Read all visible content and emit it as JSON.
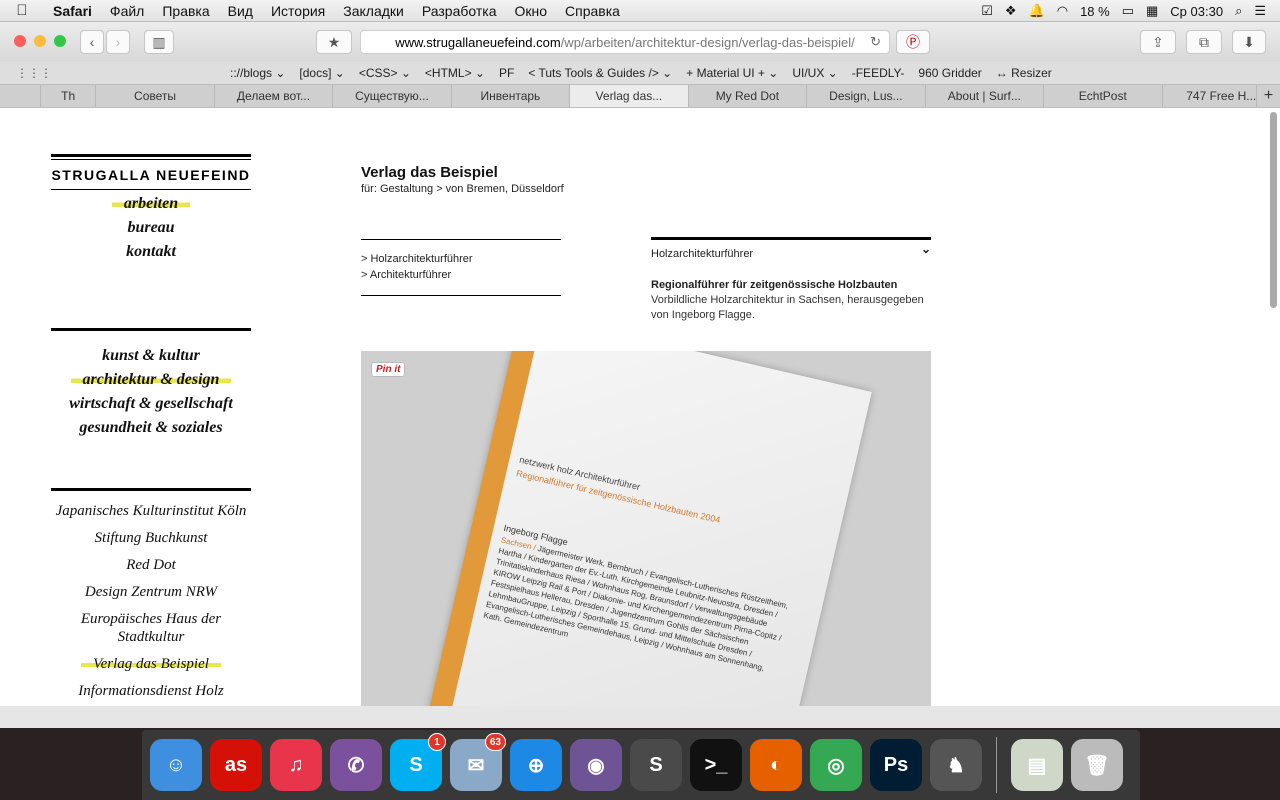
{
  "menubar": {
    "app": "Safari",
    "items": [
      "Файл",
      "Правка",
      "Вид",
      "История",
      "Закладки",
      "Разработка",
      "Окно",
      "Справка"
    ],
    "battery": "18 %",
    "clock": "Ср 03:30"
  },
  "toolbar": {
    "url_host": "www.strugallaneuefeind.com",
    "url_path": "/wp/arbeiten/architektur-design/verlag-das-beispiel/"
  },
  "bookmarks": [
    ":://blogs ⌄",
    "[docs] ⌄",
    "<CSS> ⌄",
    "<HTML> ⌄",
    "PF",
    "< Tuts Tools & Guides /> ⌄",
    "+ Material UI + ⌄",
    "UI/UX ⌄",
    "-FEEDLY-",
    "960 Gridder",
    "↔ Resizer"
  ],
  "tabs": [
    "Th",
    "Советы",
    "Делаем вот...",
    "Существую...",
    "Инвентарь",
    "Verlag das...",
    "My Red Dot",
    "Design, Lus...",
    "About | Surf...",
    "EchtPost",
    "747 Free H..."
  ],
  "active_tab": "Verlag das...",
  "sidebar": {
    "brand": "STRUGALLA NEUEFEIND",
    "nav": [
      "arbeiten",
      "bureau",
      "kontakt"
    ],
    "categories": [
      "kunst & kultur",
      "architektur & design",
      "wirtschaft & gesellschaft",
      "gesundheit & soziales"
    ],
    "clients": [
      "Japanisches Kulturinstitut Köln",
      "Stiftung Buchkunst",
      "Red Dot",
      "Design Zentrum NRW",
      "Europäisches Haus der Stadtkultur",
      "Verlag das Beispiel",
      "Informationsdienst Holz"
    ]
  },
  "main": {
    "title": "Verlag das Beispiel",
    "subtitle": "für: Gestaltung > von Bremen, Düsseldorf",
    "links": [
      "> Holzarchitekturführer",
      "> Architekturführer"
    ],
    "dropdown": "Holzarchitekturführer",
    "desc_head": "Regionalführer für zeitgenössische Holzbauten",
    "desc_body": "Vorbildliche Holzarchitektur in Sachsen, herausgegeben von Ingeborg Flagge.",
    "pin_label": "Pin it"
  },
  "book": {
    "series": "netzwerk holz Architekturführer",
    "sub": "Regionalführer für zeitgenössische Holzbauten 2004",
    "author": "Ingeborg Flagge",
    "region": "Sachsen /",
    "text": "Jägermeister Werk, Bernbruch / Evangelisch-Lutherisches Rüstzeitheim, Hartha / Kindergarten der Ev.-Luth. Kirchgemeinde Leubnitz-Neuostra, Dresden / Trinitatiskinderhaus Riesa / Wohnhaus Rog, Braunsdorf / Verwaltungsgebäude KIROW Leipzig Rail & Port / Diakonie- und Kirchengemeindezentrum Pirna-Copitz / Festspielhaus Hellerau, Dresden / Jugendzentrum Gohlis der Sächsischen LehmbauGruppe, Leipzig / Sporthalle 15. Grund- und Mittelschule Dresden / Evangelisch-Lutherisches Gemeindehaus, Leipzig / Wohnhaus am Sonnenhang, Kath. Gemeindezentrum"
  },
  "dock": [
    {
      "name": "finder",
      "color": "#3f8fe0",
      "glyph": "☺"
    },
    {
      "name": "lastfm",
      "color": "#d51007",
      "glyph": "as"
    },
    {
      "name": "itunes",
      "color": "#e8354b",
      "glyph": "♫"
    },
    {
      "name": "viber",
      "color": "#7b519d",
      "glyph": "✆"
    },
    {
      "name": "skype",
      "color": "#00aff0",
      "glyph": "S",
      "badge": "1"
    },
    {
      "name": "mail",
      "color": "#8aa9c9",
      "glyph": "✉",
      "badge": "63"
    },
    {
      "name": "safari",
      "color": "#1e88e5",
      "glyph": "⊕"
    },
    {
      "name": "github",
      "color": "#6e5494",
      "glyph": "◉"
    },
    {
      "name": "sublime",
      "color": "#4a4a4a",
      "glyph": "S"
    },
    {
      "name": "terminal",
      "color": "#111111",
      "glyph": ">_"
    },
    {
      "name": "firefox",
      "color": "#e66000",
      "glyph": "◐"
    },
    {
      "name": "chrome",
      "color": "#34a853",
      "glyph": "◎"
    },
    {
      "name": "photoshop",
      "color": "#001d34",
      "glyph": "Ps"
    },
    {
      "name": "mamp",
      "color": "#555555",
      "glyph": "♞"
    },
    {
      "name": "downloads",
      "color": "#cfd8c8",
      "glyph": "▤"
    },
    {
      "name": "trash",
      "color": "#bbbbbb",
      "glyph": "🗑"
    }
  ]
}
